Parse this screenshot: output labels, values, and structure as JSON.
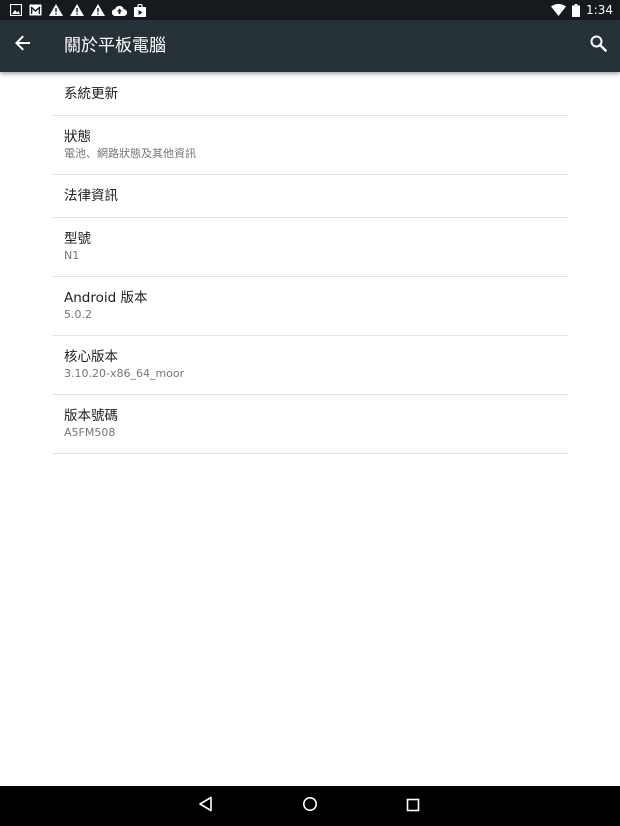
{
  "status_bar": {
    "left_icons": [
      "image-notification-icon",
      "gmail-icon",
      "warning-icon",
      "warning-icon",
      "warning-icon",
      "cloud-upload-icon",
      "shopping-bag-icon"
    ],
    "right_icons": [
      "wifi-icon",
      "battery-icon"
    ],
    "time": "1:34"
  },
  "toolbar": {
    "title": "關於平板電腦",
    "back_icon": "arrow-back-icon",
    "search_icon": "search-icon"
  },
  "settings": {
    "system_update": {
      "title": "系統更新"
    },
    "status": {
      "title": "狀態",
      "summary": "電池、網路狀態及其他資訊"
    },
    "legal_info": {
      "title": "法律資訊"
    },
    "model": {
      "title": "型號",
      "summary": "N1"
    },
    "android_version": {
      "title": "Android 版本",
      "summary": "5.0.2"
    },
    "kernel_version": {
      "title": "核心版本",
      "summary": "3.10.20-x86_64_moor"
    },
    "build_number": {
      "title": "版本號碼",
      "summary": "A5FM508"
    }
  },
  "nav_bar": {
    "icons": [
      "back-triangle-icon",
      "home-circle-icon",
      "recents-square-icon"
    ]
  },
  "colors": {
    "status_bar_bg": "#141a1d",
    "toolbar_bg": "#263238",
    "title_text": "#212121",
    "summary_text": "#757575",
    "divider": "#e3e3e3",
    "nav_bar_bg": "#000000"
  }
}
